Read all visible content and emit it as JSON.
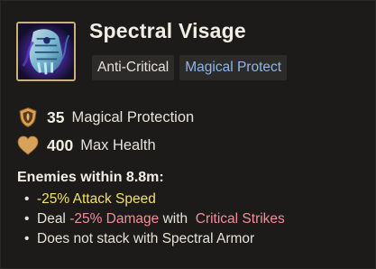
{
  "item": {
    "name": "Spectral Visage",
    "icon": "spectral-gauntlet-icon",
    "tags": [
      "Anti-Critical",
      "Magical Protect"
    ]
  },
  "stats": [
    {
      "icon": "shield-icon",
      "value": "35",
      "label": "Magical Protection"
    },
    {
      "icon": "heart-icon",
      "value": "400",
      "label": "Max Health"
    }
  ],
  "passive": {
    "header": "Enemies within 8.8m:",
    "effects": [
      {
        "bullet": "•",
        "highlight": "-25% Attack Speed"
      },
      {
        "bullet": "•",
        "prefix": "Deal ",
        "highlight": "-25% Damage",
        "middle": " with  ",
        "keyword": "Critical Strikes"
      },
      {
        "bullet": "•",
        "text": "Does not stack with Spectral Armor"
      }
    ]
  },
  "colors": {
    "background": "#1c1b1a",
    "icon_border": "#c9b27a",
    "tag_bg": "#2c2b29",
    "tag_blue": "#8fb6e8",
    "highlight_yellow": "#f1e06a",
    "highlight_pink": "#f08f98",
    "stat_icon_gold": "#d8a25a"
  }
}
